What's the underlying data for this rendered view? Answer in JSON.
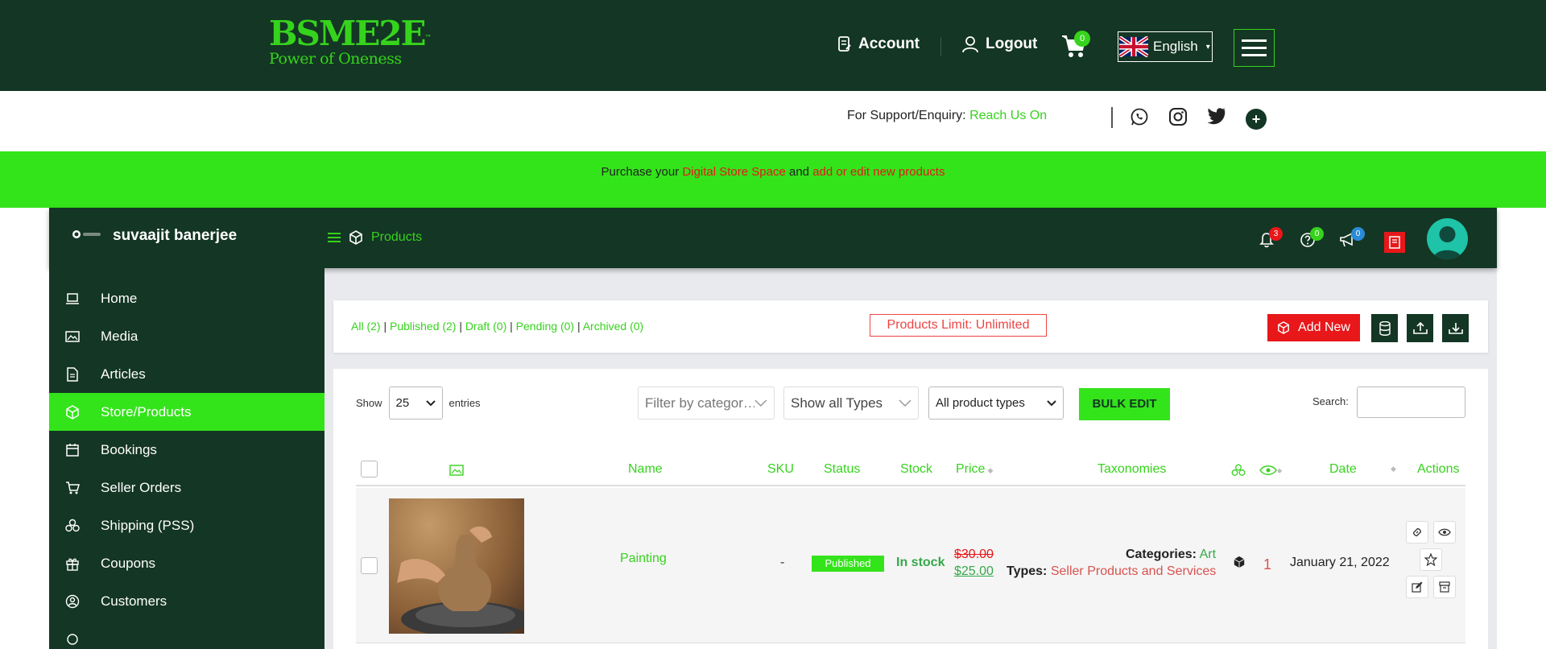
{
  "header": {
    "logo_text": "BSME2E",
    "logo_tm": "™",
    "logo_tagline": "Power of Oneness",
    "account_label": "Account",
    "logout_label": "Logout",
    "cart_count": "0",
    "language": "English",
    "language_caret": "▾"
  },
  "support": {
    "label": "For Support/Enquiry:",
    "link_text": "Reach Us On",
    "plus": "+"
  },
  "promo": {
    "prefix": "Purchase your",
    "link1": "Digital Store Space",
    "middle": "and",
    "link2": "add or edit new products"
  },
  "dashboard": {
    "store_name": "suvaajit banerjee",
    "breadcrumb": "Products",
    "notifications_count": "3",
    "help_count": "0",
    "announcements_count": "0"
  },
  "sidebar": {
    "items": [
      {
        "label": "Home",
        "icon": "laptop-icon"
      },
      {
        "label": "Media",
        "icon": "image-icon"
      },
      {
        "label": "Articles",
        "icon": "document-icon"
      },
      {
        "label": "Store/Products",
        "icon": "cube-icon"
      },
      {
        "label": "Bookings",
        "icon": "calendar-icon"
      },
      {
        "label": "Seller Orders",
        "icon": "cart-icon"
      },
      {
        "label": "Shipping (PSS)",
        "icon": "shipping-icon"
      },
      {
        "label": "Coupons",
        "icon": "gift-icon"
      },
      {
        "label": "Customers",
        "icon": "user-circle-icon"
      }
    ],
    "active_index": 3
  },
  "status_filters": {
    "all": "All (2)",
    "published": "Published (2)",
    "draft": "Draft (0)",
    "pending": "Pending (0)",
    "archived": "Archived (0)",
    "separator": "|"
  },
  "products_limit": "Products Limit: Unlimited",
  "add_new_label": "Add New",
  "table_controls": {
    "show_label": "Show",
    "entries_value": "25",
    "entries_label": "entries",
    "category_placeholder": "Filter by categor…",
    "types_select": "Show all Types",
    "product_types_select": "All product types",
    "bulk_edit": "BULK EDIT",
    "search_label": "Search:"
  },
  "table": {
    "columns": {
      "name": "Name",
      "sku": "SKU",
      "status": "Status",
      "stock": "Stock",
      "price": "Price",
      "taxonomies": "Taxonomies",
      "date": "Date",
      "actions": "Actions"
    },
    "rows": [
      {
        "name": "Painting",
        "sku": "-",
        "status": "Published",
        "stock": "In stock",
        "price_old": "$30.00",
        "price_new": "$25.00",
        "categories_label": "Categories:",
        "categories_value": "Art",
        "types_label": "Types:",
        "types_value": "Seller Products and Services",
        "views": "1",
        "date": "January 21, 2022"
      }
    ]
  },
  "colors": {
    "dark_green": "#143624",
    "bright_green": "#33e41a",
    "accent_red": "#e8171a"
  }
}
